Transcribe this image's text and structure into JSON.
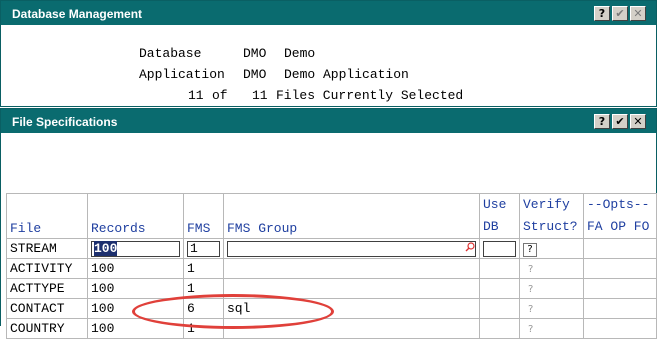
{
  "db_panel": {
    "title": "Database Management",
    "database_label": "Database",
    "database_code": "DMO",
    "database_name": "Demo",
    "application_label": "Application",
    "application_code": "DMO",
    "application_name": "Demo Application",
    "files_selected": "11",
    "files_of": "of",
    "files_total": "11",
    "files_text": "Files Currently Selected",
    "btn_help": "?",
    "btn_ok": "✔",
    "btn_close": "✕"
  },
  "file_panel": {
    "title": "File Specifications",
    "btn_help": "?",
    "btn_ok": "✔",
    "btn_close": "✕"
  },
  "table": {
    "headers": {
      "file": "File",
      "records": "Records",
      "fms": "FMS",
      "fms_group": "FMS Group",
      "use_db_top": "Use",
      "use_db_bottom": "DB",
      "verify_top": "Verify",
      "verify_bottom": "Struct?",
      "opts_top": "--Opts--",
      "opts_bottom": "FA OP FO"
    },
    "rows": [
      {
        "file": "STREAM",
        "records": "100",
        "fms": "1",
        "fms_group": "",
        "verify": "?"
      },
      {
        "file": "ACTIVITY",
        "records": "100",
        "fms": "1",
        "fms_group": "",
        "verify": "?"
      },
      {
        "file": "ACTTYPE",
        "records": "100",
        "fms": "1",
        "fms_group": "",
        "verify": "?"
      },
      {
        "file": "CONTACT",
        "records": "100",
        "fms": "6",
        "fms_group": "sql",
        "verify": "?"
      },
      {
        "file": "COUNTRY",
        "records": "100",
        "fms": "1",
        "fms_group": "",
        "verify": "?"
      }
    ]
  },
  "colors": {
    "titlebar": "#0a6b6f",
    "header_text": "#1f3fa0",
    "annotation": "#e0403a",
    "selection": "#1c2f6e"
  }
}
